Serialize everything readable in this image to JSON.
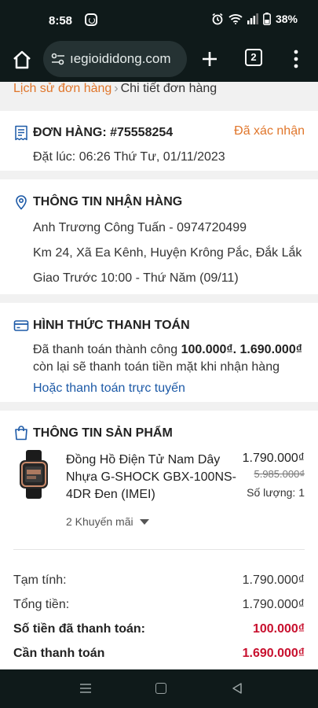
{
  "status_bar": {
    "time": "8:58",
    "battery": "38%"
  },
  "browser": {
    "url": "ıegioididong.com",
    "tab_count": "2"
  },
  "breadcrumb": {
    "history": "Lịch sử đơn hàng",
    "separator": "›",
    "current": "Chi tiết đơn hàng"
  },
  "order": {
    "title": "ĐƠN HÀNG: #75558254",
    "status": "Đã xác nhận",
    "placed_at": "Đặt lúc: 06:26 Thứ Tư, 01/11/2023"
  },
  "receiver": {
    "title": "THÔNG TIN NHẬN HÀNG",
    "name_phone": "Anh Trương Công Tuấn - 0974720499",
    "address": "Km 24, Xã Ea Kênh, Huyện Krông Pắc, Đắk Lắk",
    "delivery": "Giao Trước 10:00 - Thứ Năm (09/11)"
  },
  "payment": {
    "title": "HÌNH THỨC THANH TOÁN",
    "paid_prefix": "Đã thanh toán thành công ",
    "paid_amount": "100.000₫",
    "remaining_amount": "1.690.000₫",
    "remaining_suffix": "còn lại sẽ thanh toán tiền mặt khi nhận hàng",
    "online_link": "Hoặc thanh toán trực tuyến"
  },
  "product": {
    "title": "THÔNG TIN SẢN PHẨM",
    "name": "Đồng Hồ Điện Tử Nam Dây Nhựa G-SHOCK GBX-100NS-4DR Đen (IMEI)",
    "price": "1.790.000₫",
    "old_price": "5.985.000₫",
    "quantity": "Số lượng: 1",
    "promotions": "2 Khuyến mãi"
  },
  "summary": {
    "subtotal_label": "Tạm tính:",
    "subtotal_value": "1.790.000₫",
    "total_label": "Tổng tiền:",
    "total_value": "1.790.000₫",
    "paid_label": "Số tiền đã thanh toán:",
    "paid_value": "100.000₫",
    "due_label": "Cần thanh toán",
    "due_value": "1.690.000₫"
  },
  "colors": {
    "accent_orange": "#e0762b",
    "link_blue": "#1d5aa7",
    "price_red": "#c8102e",
    "chrome_dark": "#0f1a1a"
  }
}
